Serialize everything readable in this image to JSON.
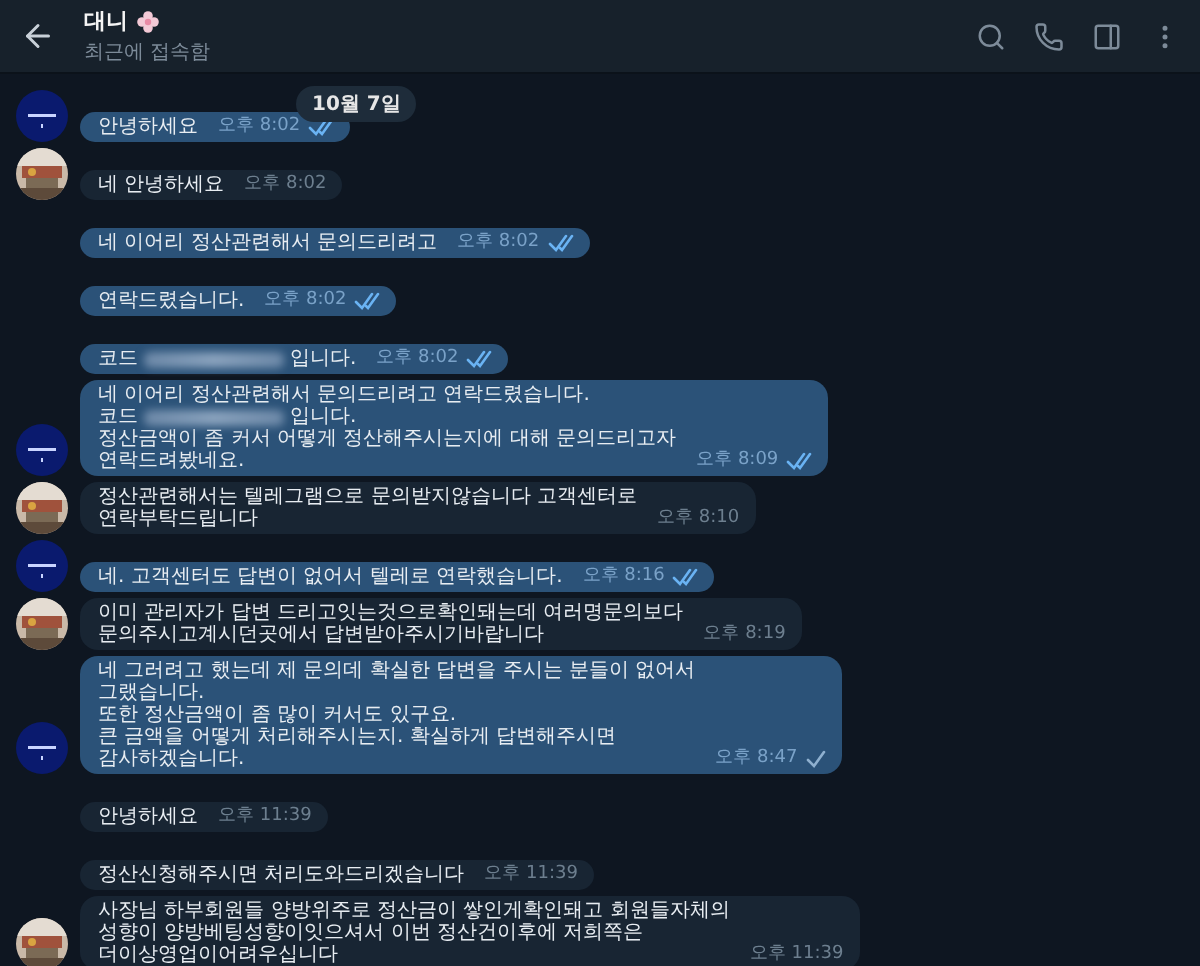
{
  "header": {
    "title": "대니",
    "status": "최근에 접속함"
  },
  "date_badge": "10월 7일",
  "messages": [
    {
      "kind": "outgoing",
      "avatar": true,
      "time": "오후 8:02",
      "read": true,
      "lines": [
        {
          "kind": "text",
          "text": "안녕하세요"
        }
      ]
    },
    {
      "kind": "incoming",
      "avatar": true,
      "time": "오후 8:02",
      "lines": [
        {
          "kind": "text",
          "text": "네 안녕하세요"
        }
      ]
    },
    {
      "kind": "outgoing",
      "avatar": false,
      "time": "오후 8:02",
      "read": true,
      "lines": [
        {
          "kind": "text",
          "text": "네 이어리 정산관련해서 문의드리려고"
        }
      ]
    },
    {
      "kind": "outgoing",
      "avatar": false,
      "time": "오후 8:02",
      "read": true,
      "lines": [
        {
          "kind": "text",
          "text": "연락드렸습니다."
        }
      ]
    },
    {
      "kind": "outgoing",
      "avatar": false,
      "time": "오후 8:02",
      "read": true,
      "lines": [
        {
          "kind": "redacted",
          "before": "코드",
          "after": "입니다."
        }
      ]
    },
    {
      "kind": "outgoing",
      "avatar": true,
      "time": "오후 8:09",
      "read": true,
      "lines": [
        {
          "kind": "text",
          "text": "네 이어리 정산관련해서 문의드리려고 연락드렸습니다."
        },
        {
          "kind": "redacted",
          "before": "코드",
          "after": "입니다."
        },
        {
          "kind": "text",
          "text": "정산금액이 좀 커서 어떻게 정산해주시는지에 대해 문의드리고자\n연락드려봤네요."
        }
      ]
    },
    {
      "kind": "incoming",
      "avatar": true,
      "time": "오후 8:10",
      "lines": [
        {
          "kind": "text",
          "text": "정산관련해서는 텔레그램으로 문의받지않습니다 고객센터로\n연락부탁드립니다"
        }
      ]
    },
    {
      "kind": "outgoing",
      "avatar": true,
      "time": "오후 8:16",
      "read": true,
      "lines": [
        {
          "kind": "text",
          "text": "네. 고객센터도 답변이 없어서 텔레로 연락했습니다."
        }
      ]
    },
    {
      "kind": "incoming",
      "avatar": true,
      "time": "오후 8:19",
      "lines": [
        {
          "kind": "text",
          "text": "이미 관리자가 답변 드리고잇는것으로확인돼는데 여러명문의보다\n문의주시고계시던곳에서 답변받아주시기바랍니다"
        }
      ]
    },
    {
      "kind": "outgoing",
      "avatar": true,
      "time": "오후 8:47",
      "read": false,
      "lines": [
        {
          "kind": "text",
          "text": "네 그러려고 했는데 제 문의데 확실한 답변을 주시는 분들이 없어서\n그랬습니다.\n또한 정산금액이 좀 많이 커서도 있구요.\n큰 금액을 어떻게 처리해주시는지. 확실하게 답변해주시면\n감사하겠습니다."
        }
      ]
    },
    {
      "kind": "incoming",
      "avatar": false,
      "time": "오후 11:39",
      "lines": [
        {
          "kind": "text",
          "text": "안녕하세요"
        }
      ]
    },
    {
      "kind": "incoming",
      "avatar": false,
      "time": "오후 11:39",
      "lines": [
        {
          "kind": "text",
          "text": "정산신청해주시면 처리도와드리겠습니다"
        }
      ]
    },
    {
      "kind": "incoming",
      "avatar": true,
      "time": "오후 11:39",
      "lines": [
        {
          "kind": "text",
          "text": "사장님 하부회원들 양방위주로 정산금이 쌓인게확인돼고 회원들자체의\n성향이 양방베팅성향이잇으셔서 이번 정산건이후에 저희쪽은\n더이상영업이어려우십니다"
        }
      ]
    }
  ]
}
